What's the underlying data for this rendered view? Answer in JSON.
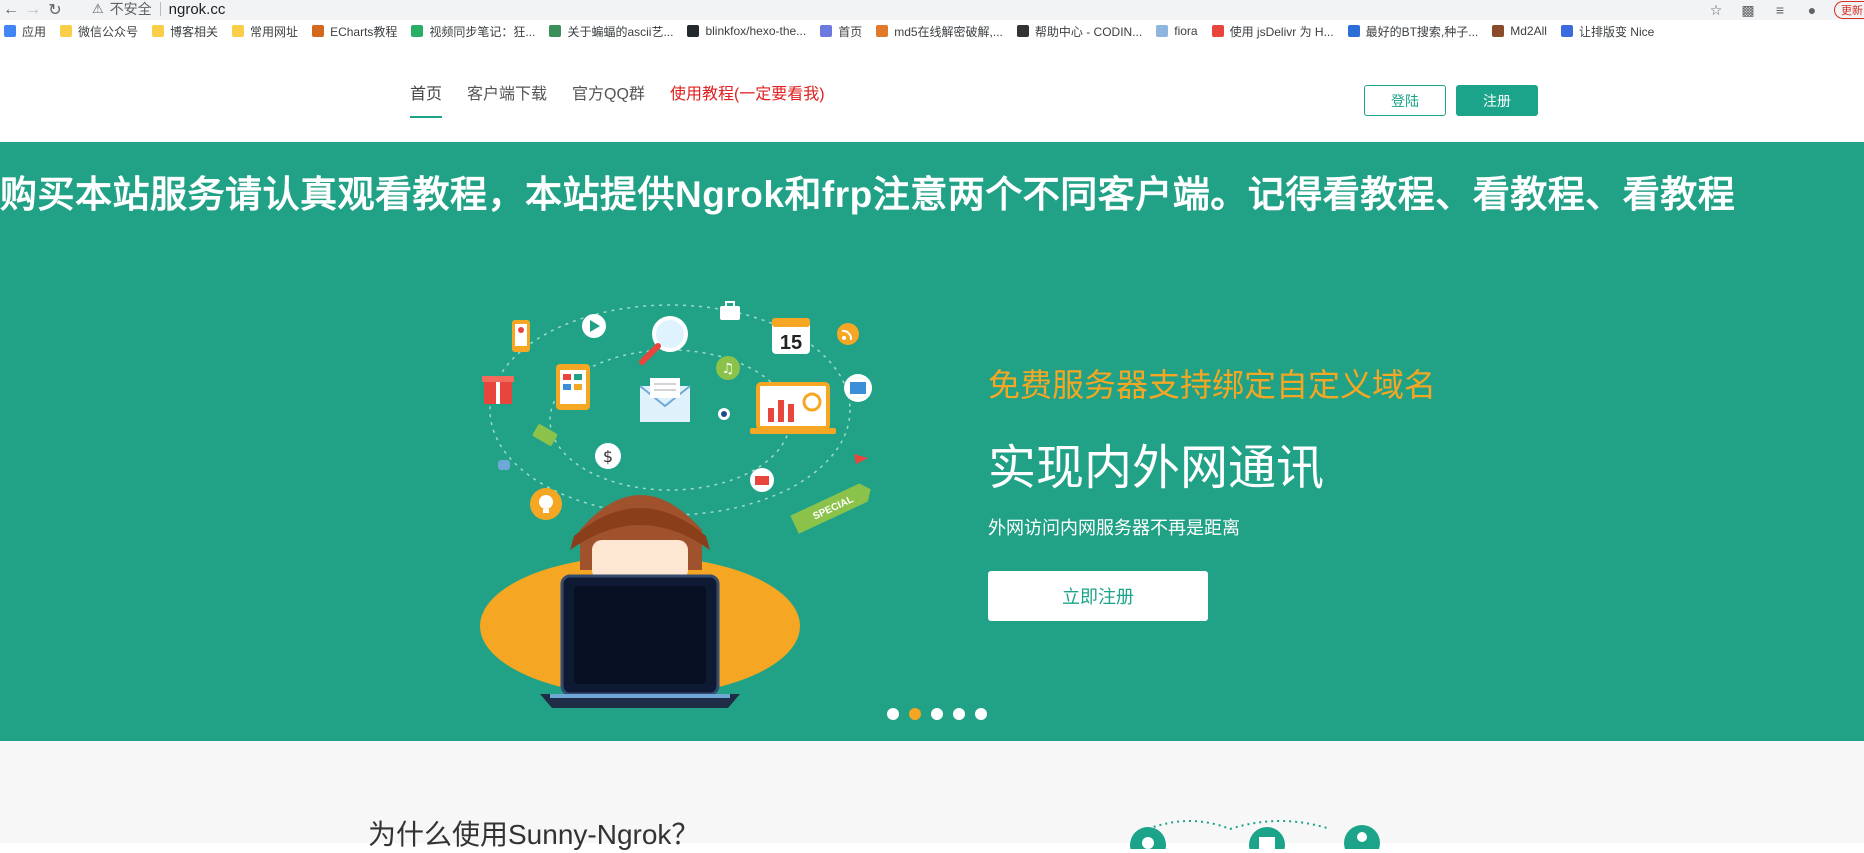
{
  "browser": {
    "security_label": "不安全",
    "url": "ngrok.cc",
    "update_label": "更新"
  },
  "bookmarks": [
    {
      "label": "应用",
      "icon": "apps-grid-icon",
      "color": "#4285f4"
    },
    {
      "label": "微信公众号",
      "icon": "folder-icon",
      "color": "#f9cf4a"
    },
    {
      "label": "博客相关",
      "icon": "folder-icon",
      "color": "#f9cf4a"
    },
    {
      "label": "常用网址",
      "icon": "folder-icon",
      "color": "#f9cf4a"
    },
    {
      "label": "ECharts教程",
      "icon": "echarts-icon",
      "color": "#d4691e"
    },
    {
      "label": "视频同步笔记：狂...",
      "icon": "wechat-icon",
      "color": "#2aae67"
    },
    {
      "label": "关于蝙蝠的ascii艺...",
      "icon": "leaf-icon",
      "color": "#3a8f5a"
    },
    {
      "label": "blinkfox/hexo-the...",
      "icon": "github-icon",
      "color": "#24292e"
    },
    {
      "label": "首页",
      "icon": "globe-icon",
      "color": "#6c7ae0"
    },
    {
      "label": "md5在线解密破解,...",
      "icon": "md5-icon",
      "color": "#e07a2a"
    },
    {
      "label": "帮助中心 - CODIN...",
      "icon": "coding-icon",
      "color": "#333333"
    },
    {
      "label": "fiora",
      "icon": "avatar-icon",
      "color": "#8fb6e0"
    },
    {
      "label": "使用 jsDelivr 为 H...",
      "icon": "c-logo-icon",
      "color": "#e8453c"
    },
    {
      "label": "最好的BT搜索,种子...",
      "icon": "bt-icon",
      "color": "#2b6fd6"
    },
    {
      "label": "Md2All",
      "icon": "md2all-icon",
      "color": "#8a4b2a"
    },
    {
      "label": "让排版变 Nice",
      "icon": "nice-icon",
      "color": "#3b6be0"
    }
  ],
  "nav": {
    "items": [
      {
        "label": "首页",
        "active": true
      },
      {
        "label": "客户端下载",
        "active": false
      },
      {
        "label": "官方QQ群",
        "active": false
      },
      {
        "label": "使用教程(一定要看我)",
        "active": false,
        "color": "#e02020"
      }
    ],
    "login_label": "登陆",
    "register_label": "注册"
  },
  "hero": {
    "marquee": "购买本站服务请认真观看教程，本站提供Ngrok和frp注意两个不同客户端。记得看教程、看教程、看教程",
    "sub_title": "免费服务器支持绑定自定义域名",
    "title": "实现内外网通讯",
    "description": "外网访问内网服务器不再是距离",
    "cta_label": "立即注册",
    "slides_count": 5,
    "active_slide": 2,
    "calendar_number": "15",
    "badge_text": "SPECIAL",
    "colors": {
      "background": "#21a286",
      "accent": "#f5a623",
      "brand": "#1ba489"
    }
  },
  "section": {
    "title": "为什么使用Sunny-Ngrok？"
  }
}
